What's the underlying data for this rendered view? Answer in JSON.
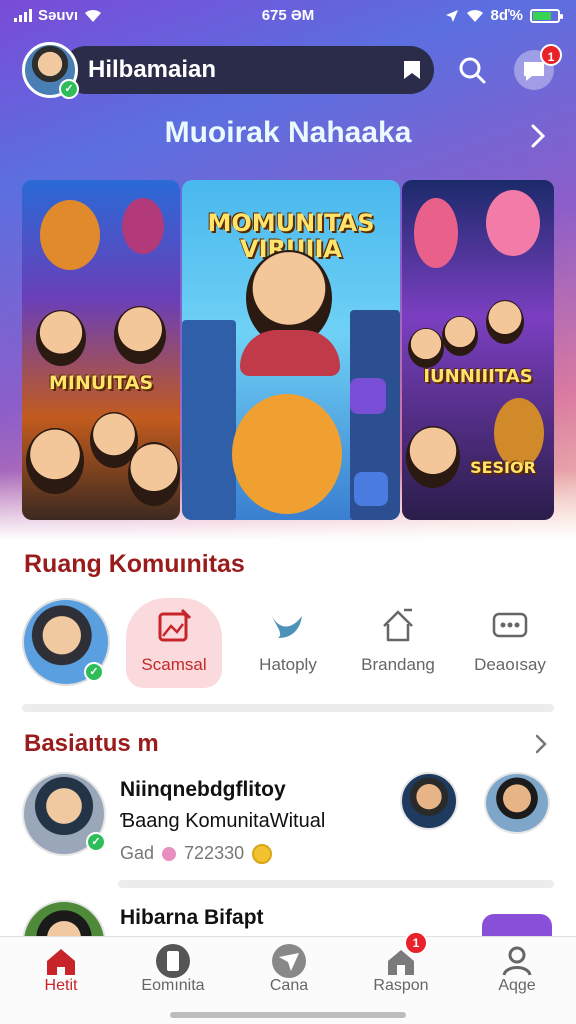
{
  "status_bar": {
    "carrier": "Sǝuvı",
    "time": "675 ƏM",
    "battery": "8ď%"
  },
  "header": {
    "search_text": "Hilbamaian",
    "notification_count": "1"
  },
  "hero": {
    "title": "Muoirak Nahaaka",
    "cards": [
      {
        "labels": [
          "MINUITAS"
        ]
      },
      {
        "labels": [
          "MOMUNITAS VIRUIIA"
        ]
      },
      {
        "labels": [
          "IUNNIIITAS",
          "SESIOR"
        ]
      }
    ]
  },
  "community_section": {
    "title": "Ruang Komuınitas",
    "items": [
      {
        "label": "Scamsal",
        "icon": "image-edit-icon",
        "active": true
      },
      {
        "label": "Hatoply",
        "icon": "bird-icon"
      },
      {
        "label": "Brandang",
        "icon": "house-arrow-icon"
      },
      {
        "label": "Deaoısay",
        "icon": "chat-dots-icon"
      }
    ]
  },
  "feed_section": {
    "title": "Basiaıtus m",
    "rows": [
      {
        "title": "Niinqnebdgflitoy",
        "subtitle": "Ɓaang KomunitaWitual",
        "meta": "Gad",
        "count": "722330"
      },
      {
        "title": "Hibarna Bifapt"
      }
    ]
  },
  "bottom_nav": {
    "items": [
      {
        "label": "Hetit",
        "icon": "home-icon",
        "active": true
      },
      {
        "label": "Eomınita",
        "icon": "phone-icon"
      },
      {
        "label": "Cana",
        "icon": "compass-icon"
      },
      {
        "label": "Raspon",
        "icon": "house-icon",
        "badge": "1"
      },
      {
        "label": "Aqge",
        "icon": "person-icon"
      }
    ]
  },
  "colors": {
    "accent": "#c8252b",
    "section_title": "#9a1b1b",
    "badge": "#e8222b",
    "verified": "#2ebd59"
  }
}
